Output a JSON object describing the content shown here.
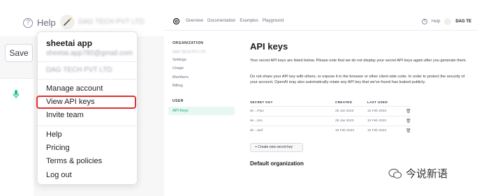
{
  "left": {
    "help_label": "Help",
    "org_name_blurred": "DAG TECH PVT LTD",
    "save_label": "Save",
    "menu": {
      "user_name": "sheetai app",
      "email_blurred": "sheetai.app780@gmail.com",
      "org_blurred": "DAG TECH PVT LTD",
      "items": [
        "Manage account",
        "View API keys",
        "Invite team",
        "Help",
        "Pricing",
        "Terms & policies",
        "Log out"
      ],
      "highlighted_item": "View API keys",
      "highlight_color": "#e0302e"
    }
  },
  "right": {
    "nav": [
      "Overview",
      "Documentation",
      "Examples",
      "Playground"
    ],
    "help_label": "Help",
    "org_short": "DAG TE",
    "sidebar": {
      "org_heading": "ORGANIZATION",
      "org_name_blurred": "DAG TECH PVT LTD",
      "org_items": [
        "Settings",
        "Usage",
        "Members",
        "Billing"
      ],
      "user_heading": "USER",
      "active_item": "API Keys",
      "accent": "#10a37f"
    },
    "main": {
      "title": "API keys",
      "para1": "Your secret API keys are listed below. Please note that we do not display your secret API keys again after you generate them.",
      "para2": "Do not share your API key with others, or expose it in the browser or other client-side code. In order to protect the security of your account, OpenAI may also automatically rotate any API key that we've found has leaked publicly.",
      "columns": [
        "SECRET KEY",
        "CREATED",
        "LAST USED"
      ],
      "rows": [
        {
          "key": "sk-...Piyo",
          "created": "25 Jan 2023",
          "last_used": "15 Feb 2023"
        },
        {
          "key": "sk-...txrL",
          "created": "25 Jan 2023",
          "last_used": "15 Feb 2023"
        },
        {
          "key": "sk-...tanf",
          "created": "16 Feb 2023",
          "last_used": "15 Feb 2023"
        }
      ],
      "create_button": "+ Create new secret key",
      "default_org_heading": "Default organization"
    }
  },
  "watermark": "今说新语"
}
